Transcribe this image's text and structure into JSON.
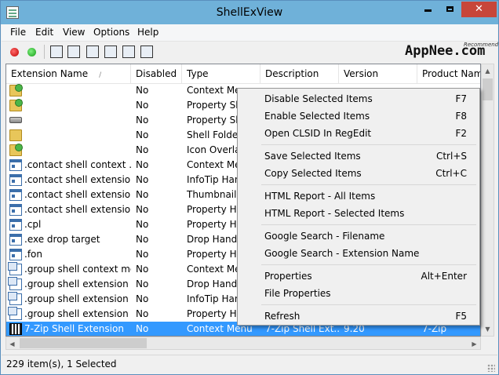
{
  "window": {
    "title": "ShellExView",
    "close_glyph": "✕"
  },
  "menubar": [
    "File",
    "Edit",
    "View",
    "Options",
    "Help"
  ],
  "toolbar": {
    "icons": [
      "disable-red-icon",
      "enable-green-icon",
      "save-icon",
      "refresh-icon",
      "copy-icon",
      "properties-icon",
      "find-icon",
      "exit-icon"
    ],
    "logo_text": "AppNee.com",
    "logo_sub": "Recommend"
  },
  "list": {
    "columns": [
      "Extension Name",
      "Disabled",
      "Type",
      "Description",
      "Version",
      "Product Name"
    ],
    "rows": [
      {
        "icon": "folder-green-icon",
        "name": "",
        "disabled": "No",
        "type": "Context Menu",
        "description": "",
        "version": "",
        "product": ""
      },
      {
        "icon": "folder-green-icon",
        "name": "",
        "disabled": "No",
        "type": "Property Sheet",
        "description": "",
        "version": "",
        "product": ""
      },
      {
        "icon": "drive-icon",
        "name": "",
        "disabled": "No",
        "type": "Property Sheet",
        "description": "",
        "version": "",
        "product": ""
      },
      {
        "icon": "folder-icon",
        "name": "",
        "disabled": "No",
        "type": "Shell Folder",
        "description": "",
        "version": "",
        "product": ""
      },
      {
        "icon": "folder-green-icon",
        "name": "",
        "disabled": "No",
        "type": "Icon Overlay",
        "description": "",
        "version": "",
        "product": ""
      },
      {
        "icon": "window-icon",
        "name": ".contact shell context ...",
        "disabled": "No",
        "type": "Context Menu",
        "description": "",
        "version": "",
        "product": ""
      },
      {
        "icon": "window-icon",
        "name": ".contact shell extension...",
        "disabled": "No",
        "type": "InfoTip Handler",
        "description": "",
        "version": "",
        "product": ""
      },
      {
        "icon": "window-icon",
        "name": ".contact shell extension...",
        "disabled": "No",
        "type": "Thumbnail",
        "description": "",
        "version": "",
        "product": ""
      },
      {
        "icon": "window-icon",
        "name": ".contact shell extension...",
        "disabled": "No",
        "type": "Property Handler",
        "description": "",
        "version": "",
        "product": ""
      },
      {
        "icon": "window-icon",
        "name": ".cpl",
        "disabled": "No",
        "type": "Property Handler",
        "description": "",
        "version": "",
        "product": ""
      },
      {
        "icon": "window-icon",
        "name": ".exe drop target",
        "disabled": "No",
        "type": "Drop Handler",
        "description": "",
        "version": "",
        "product": ""
      },
      {
        "icon": "window-icon",
        "name": ".fon",
        "disabled": "No",
        "type": "Property Handler",
        "description": "",
        "version": "",
        "product": ""
      },
      {
        "icon": "group-icon",
        "name": ".group shell context me...",
        "disabled": "No",
        "type": "Context Menu",
        "description": "",
        "version": "",
        "product": ""
      },
      {
        "icon": "group-icon",
        "name": ".group shell extension h...",
        "disabled": "No",
        "type": "Drop Handler",
        "description": "",
        "version": "",
        "product": ""
      },
      {
        "icon": "group-icon",
        "name": ".group shell extension h...",
        "disabled": "No",
        "type": "InfoTip Handler",
        "description": "",
        "version": "",
        "product": ""
      },
      {
        "icon": "group-icon",
        "name": ".group shell extension h...",
        "disabled": "No",
        "type": "Property Handler",
        "description": "",
        "version": "",
        "product": ""
      },
      {
        "icon": "sevenzip-icon",
        "name": "7-Zip Shell Extension",
        "disabled": "No",
        "type": "Context Menu",
        "description": "7-Zip Shell Ext...",
        "version": "9.20",
        "product": "7-Zip",
        "selected": true
      }
    ]
  },
  "context_menu": {
    "groups": [
      [
        {
          "label": "Disable Selected Items",
          "key": "F7"
        },
        {
          "label": "Enable Selected Items",
          "key": "F8"
        },
        {
          "label": "Open CLSID In RegEdit",
          "key": "F2"
        }
      ],
      [
        {
          "label": "Save Selected Items",
          "key": "Ctrl+S"
        },
        {
          "label": "Copy Selected Items",
          "key": "Ctrl+C"
        }
      ],
      [
        {
          "label": "HTML Report - All Items",
          "key": ""
        },
        {
          "label": "HTML Report - Selected Items",
          "key": ""
        }
      ],
      [
        {
          "label": "Google Search - Filename",
          "key": ""
        },
        {
          "label": "Google Search - Extension Name",
          "key": ""
        }
      ],
      [
        {
          "label": "Properties",
          "key": "Alt+Enter"
        },
        {
          "label": "File Properties",
          "key": ""
        }
      ],
      [
        {
          "label": "Refresh",
          "key": "F5"
        }
      ]
    ]
  },
  "statusbar": {
    "text": "229 item(s), 1 Selected"
  },
  "colors": {
    "titlebar": "#6fb1d9",
    "selection": "#3399ff",
    "close_button": "#c7463a"
  }
}
